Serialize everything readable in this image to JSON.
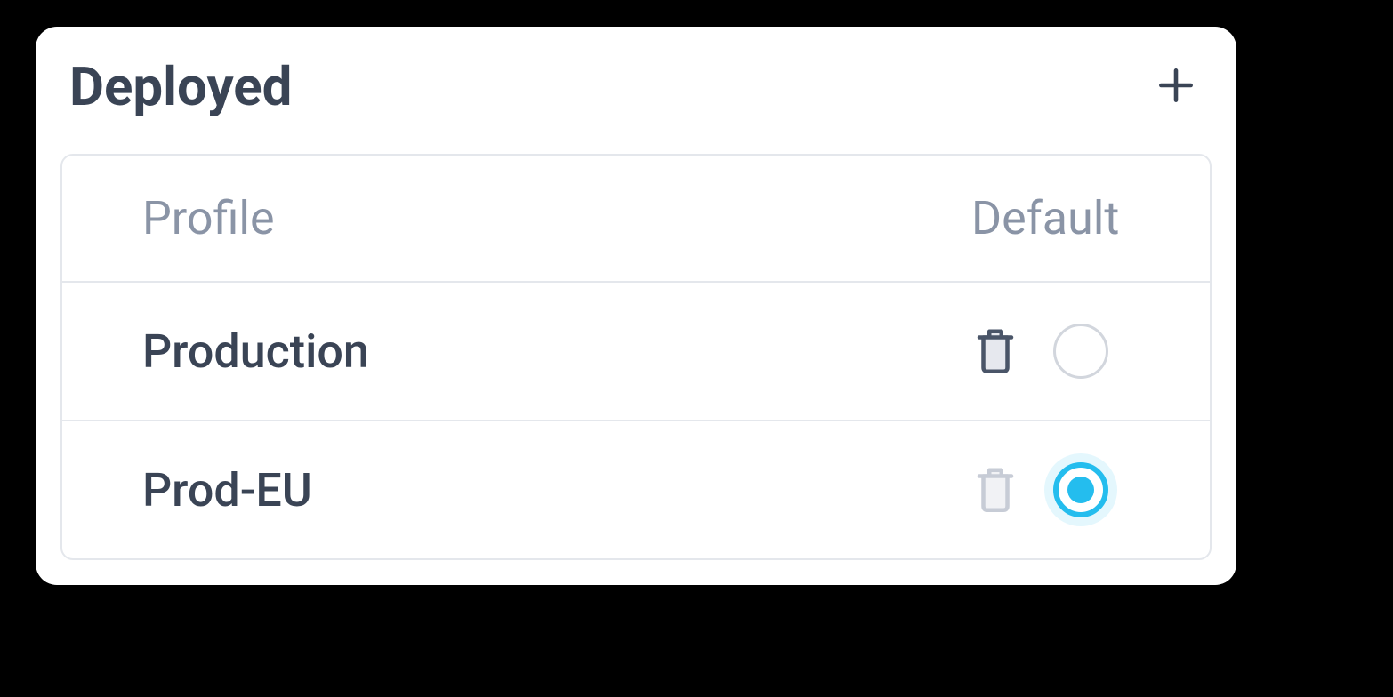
{
  "panel": {
    "title": "Deployed",
    "columns": {
      "profile": "Profile",
      "default": "Default"
    },
    "rows": [
      {
        "name": "Production",
        "selected": false,
        "trash_style": "dark"
      },
      {
        "name": "Prod-EU",
        "selected": true,
        "trash_style": "light"
      }
    ]
  }
}
